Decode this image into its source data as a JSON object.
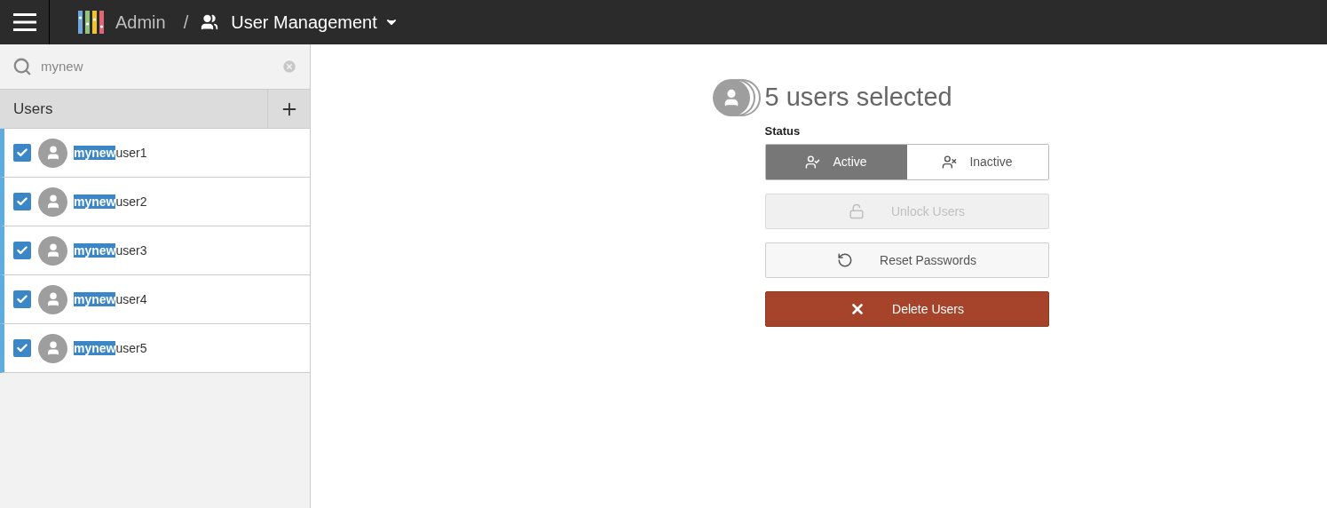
{
  "header": {
    "app": "Admin",
    "separator": "/",
    "section": "User Management"
  },
  "search": {
    "value": "mynew"
  },
  "list": {
    "title": "Users",
    "users": [
      {
        "match": "mynew",
        "rest": "user1",
        "checked": true,
        "selected": true
      },
      {
        "match": "mynew",
        "rest": "user2",
        "checked": true,
        "selected": true
      },
      {
        "match": "mynew",
        "rest": "user3",
        "checked": true,
        "selected": true
      },
      {
        "match": "mynew",
        "rest": "user4",
        "checked": true,
        "selected": true
      },
      {
        "match": "mynew",
        "rest": "user5",
        "checked": true,
        "selected": true
      }
    ]
  },
  "detail": {
    "title": "5 users selected",
    "status_label": "Status",
    "status_options": [
      {
        "label": "Active",
        "kind": "active",
        "selected": true
      },
      {
        "label": "Inactive",
        "kind": "inactive",
        "selected": false
      }
    ],
    "actions": [
      {
        "label": "Unlock Users",
        "kind": "unlock",
        "disabled": true
      },
      {
        "label": "Reset Passwords",
        "kind": "reset",
        "disabled": false
      },
      {
        "label": "Delete Users",
        "kind": "delete",
        "disabled": false
      }
    ]
  }
}
